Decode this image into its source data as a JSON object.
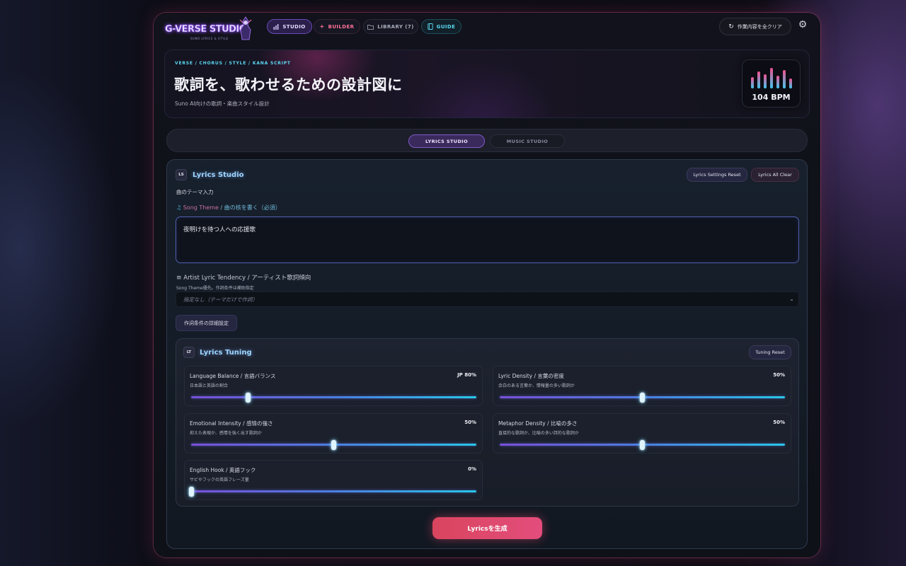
{
  "nav": {
    "logo_text": "G-VERSE STUDIO",
    "logo_sub": "SUNO LYRICS & STYLE",
    "tabs": [
      {
        "label": "STUDIO",
        "icon": "bar-chart-icon"
      },
      {
        "label": "BUILDER",
        "icon": "plus-icon"
      },
      {
        "label": "LIBRARY (7)",
        "icon": "folder-icon"
      },
      {
        "label": "GUIDE",
        "icon": "book-icon"
      }
    ],
    "clear_label": "作業内容を全クリア",
    "clear_icon": "refresh-icon",
    "settings_icon": "gear-icon"
  },
  "hero": {
    "tags": "VERSE / CHORUS / STYLE / KANA SCRIPT",
    "title": "歌詞を、歌わせるための設計図に",
    "subtitle": "Suno AI向けの歌詞・楽曲スタイル設計",
    "bpm": 104,
    "bpm_label": "104 BPM"
  },
  "studio_toggle": {
    "lyrics": "LYRICS STUDIO",
    "music": "MUSIC STUDIO",
    "active": "lyrics"
  },
  "lyrics_studio": {
    "badge": "LS",
    "title": "Lyrics Studio",
    "settings_reset": "Lyrics Settings Reset",
    "all_clear": "Lyrics All Clear",
    "theme_section_label": "曲のテーマ入力",
    "theme_label_en": "Song Theme",
    "theme_label_sep": " / ",
    "theme_label_jp": "曲の核を書く（必須）",
    "theme_value": "夜明けを待つ人への応援歌",
    "tendency_label": "Artist Lyric Tendency / アーティスト歌詞傾向",
    "tendency_note": "Song Theme優先。作詞条件は補助指定",
    "tendency_value": "指定なし（テーマだけで作詞）",
    "detail_button": "作詞条件の詳細設定",
    "generate_button": "Lyricsを生成"
  },
  "tuning": {
    "badge": "LT",
    "title": "Lyrics Tuning",
    "reset": "Tuning Reset",
    "sliders": [
      {
        "title": "Language Balance / 言語バランス",
        "desc": "日本語と英語の割合",
        "value_label": "JP 80%",
        "fraction": 0.2
      },
      {
        "title": "Lyric Density / 言葉の密度",
        "desc": "余白のある言葉か、情報量の多い歌詞か",
        "value_label": "50%",
        "fraction": 0.5
      },
      {
        "title": "Emotional Intensity / 感情の強さ",
        "desc": "抑えた表現か、感情を強く出す歌詞か",
        "value_label": "50%",
        "fraction": 0.5
      },
      {
        "title": "Metaphor Density / 比喩の多さ",
        "desc": "直接的な歌詞か、比喩の多い詩的な歌詞か",
        "value_label": "50%",
        "fraction": 0.5
      },
      {
        "title": "English Hook / 英語フック",
        "desc": "サビやフックの英語フレーズ量",
        "value_label": "0%",
        "fraction": 0.0
      }
    ]
  },
  "colors": {
    "accent_purple": "#7e5bc8",
    "accent_cyan": "#57d8f0",
    "accent_pink": "#e34d7c"
  }
}
